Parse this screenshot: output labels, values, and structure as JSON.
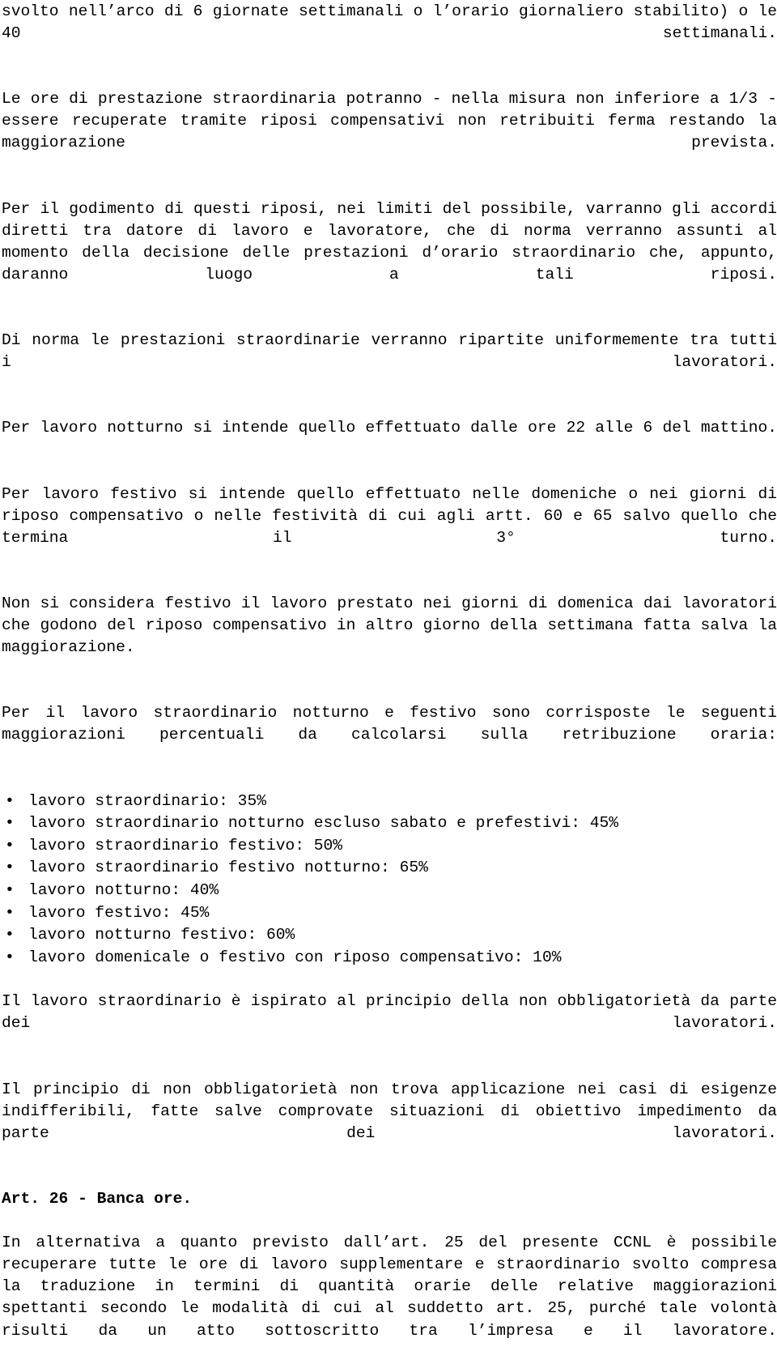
{
  "document": {
    "language": "it",
    "blocks": [
      {
        "type": "paragraph",
        "name": "paragraph-orario-settimanale",
        "text": "svolto nell’arco di 6 giornate settimanali o l’orario giornaliero stabilito) o le 40 settimanali."
      },
      {
        "type": "paragraph",
        "name": "paragraph-ore-straordinarie-recupero",
        "text": "Le ore di prestazione straordinaria potranno - nella misura non inferiore a 1/3 - essere recuperate tramite riposi compensativi non retribuiti ferma restando la maggiorazione prevista."
      },
      {
        "type": "paragraph",
        "name": "paragraph-godimento-riposi",
        "text": "Per il godimento di questi riposi, nei limiti del possibile, varranno gli accordi diretti tra datore di lavoro e lavoratore, che di norma verranno assunti al momento della decisione delle prestazioni d’orario straordinario che, appunto, daranno luogo a tali riposi."
      },
      {
        "type": "paragraph",
        "name": "paragraph-ripartizione-uniforme",
        "text": "Di norma le prestazioni straordinarie verranno ripartite uniformemente tra tutti i lavoratori."
      },
      {
        "type": "paragraph",
        "name": "paragraph-definizione-lavoro-notturno",
        "text": "Per lavoro notturno si intende quello effettuato dalle ore 22 alle 6 del mattino."
      },
      {
        "type": "paragraph",
        "name": "paragraph-definizione-lavoro-festivo",
        "text": "Per lavoro festivo si intende quello effettuato nelle domeniche o nei giorni di riposo compensativo o nelle festività di cui agli artt. 60 e 65 salvo quello che termina il 3° turno."
      },
      {
        "type": "paragraph",
        "name": "paragraph-esclusione-festivo-domenica",
        "text": "Non si considera festivo il lavoro prestato nei giorni di domenica dai lavoratori che godono del riposo compensativo in altro giorno della settimana fatta salva la maggiorazione."
      },
      {
        "type": "paragraph",
        "name": "paragraph-maggiorazioni-intro",
        "text": "Per il lavoro straordinario notturno e festivo sono corrisposte le seguenti maggiorazioni percentuali da calcolarsi sulla retribuzione oraria:"
      },
      {
        "type": "list",
        "name": "list-maggiorazioni-percentuali",
        "bullet_glyph": "•",
        "items": [
          "lavoro straordinario: 35%",
          "lavoro straordinario notturno escluso sabato e prefestivi: 45%",
          "lavoro straordinario festivo: 50%",
          "lavoro straordinario festivo notturno: 65%",
          "lavoro notturno: 40%",
          "lavoro festivo: 45%",
          "lavoro notturno festivo: 60%",
          "lavoro domenicale o festivo con riposo compensativo: 10%"
        ]
      },
      {
        "type": "paragraph",
        "name": "paragraph-non-obbligatorieta",
        "text": "Il lavoro straordinario è ispirato al principio della non obbligatorietà da parte dei lavoratori."
      },
      {
        "type": "paragraph",
        "name": "paragraph-eccezioni-non-obbligatorieta",
        "text": "Il principio di non obbligatorietà non trova applicazione nei casi di esigenze indifferibili, fatte salve comprovate situazioni di obiettivo impedimento da parte dei lavoratori."
      },
      {
        "type": "heading",
        "name": "heading-art-26-banca-ore",
        "text": "Art. 26 - Banca ore."
      },
      {
        "type": "paragraph",
        "name": "paragraph-banca-ore-alternativa",
        "text": "In alternativa a quanto previsto dall’art. 25 del presente CCNL è possibile recuperare tutte le ore di lavoro supplementare e straordinario svolto compresa la traduzione in termini di quantità orarie delle relative maggiorazioni spettanti secondo le modalità di cui al suddetto art. 25, purché tale volontà risulti da un atto sottoscritto tra l’impresa e il lavoratore."
      }
    ]
  },
  "colors": {
    "text": "#000000",
    "background": "#ffffff"
  }
}
